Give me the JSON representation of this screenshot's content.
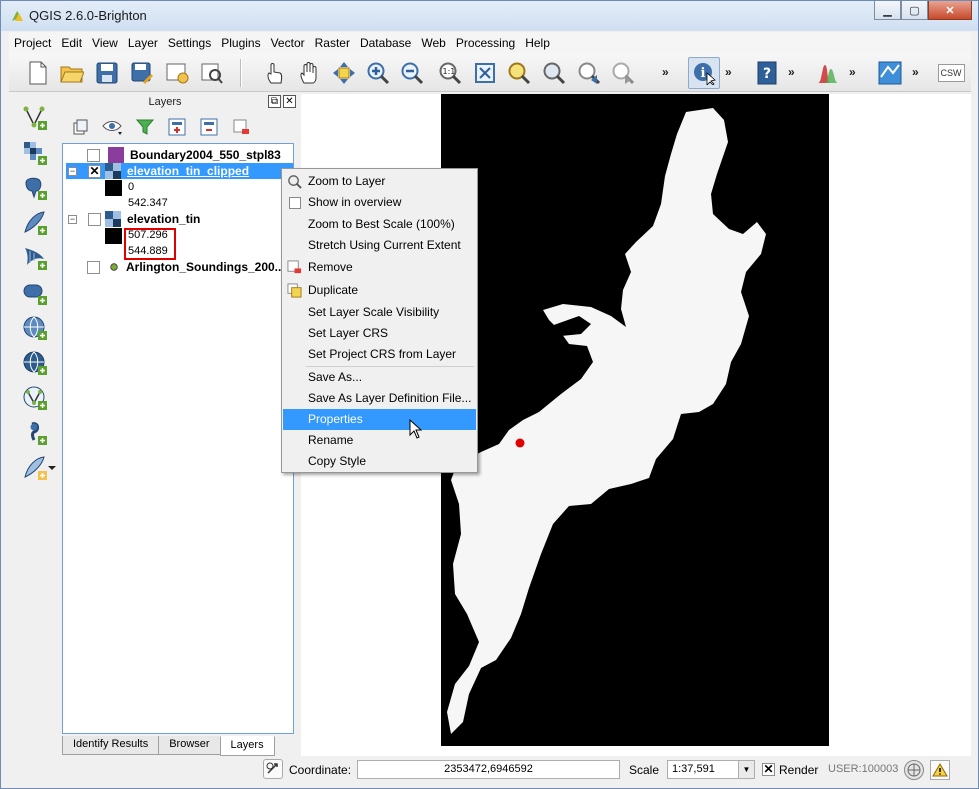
{
  "window": {
    "title": "QGIS 2.6.0-Brighton"
  },
  "menubar": [
    "Project",
    "Edit",
    "View",
    "Layer",
    "Settings",
    "Plugins",
    "Vector",
    "Raster",
    "Database",
    "Web",
    "Processing",
    "Help"
  ],
  "toolbar": {
    "more": "»",
    "csw_label": "CSW"
  },
  "layers_panel": {
    "title": "Layers",
    "layers": [
      {
        "name": "Boundary2004_550_stpl83",
        "checked": false
      },
      {
        "name": "elevation_tin_clipped",
        "checked": true,
        "legend_min": "0",
        "legend_max": "542.347"
      },
      {
        "name": "elevation_tin",
        "checked": false,
        "legend_min": "507.296",
        "legend_max": "544.889"
      },
      {
        "name": "Arlington_Soundings_200...",
        "checked": false
      }
    ],
    "tabs": [
      "Identify Results",
      "Browser",
      "Layers"
    ],
    "active_tab": "Layers"
  },
  "context_menu": {
    "items": [
      "Zoom to Layer",
      "Show in overview",
      "Zoom to Best Scale (100%)",
      "Stretch Using Current Extent",
      "Remove",
      "Duplicate",
      "Set Layer Scale Visibility",
      "Set Layer CRS",
      "Set Project CRS from Layer",
      "Save As...",
      "Save As Layer Definition File...",
      "Properties",
      "Rename",
      "Copy Style"
    ],
    "highlighted": "Properties"
  },
  "statusbar": {
    "coordinate_label": "Coordinate:",
    "coordinate_value": "2353472,6946592",
    "scale_label": "Scale",
    "scale_value": "1:37,591",
    "render_label": "Render",
    "user_text": "USER:100003"
  },
  "colors": {
    "selection": "#3399ff",
    "boundary_swatch": "#8b3d9e",
    "highlight_box": "#e00000"
  }
}
